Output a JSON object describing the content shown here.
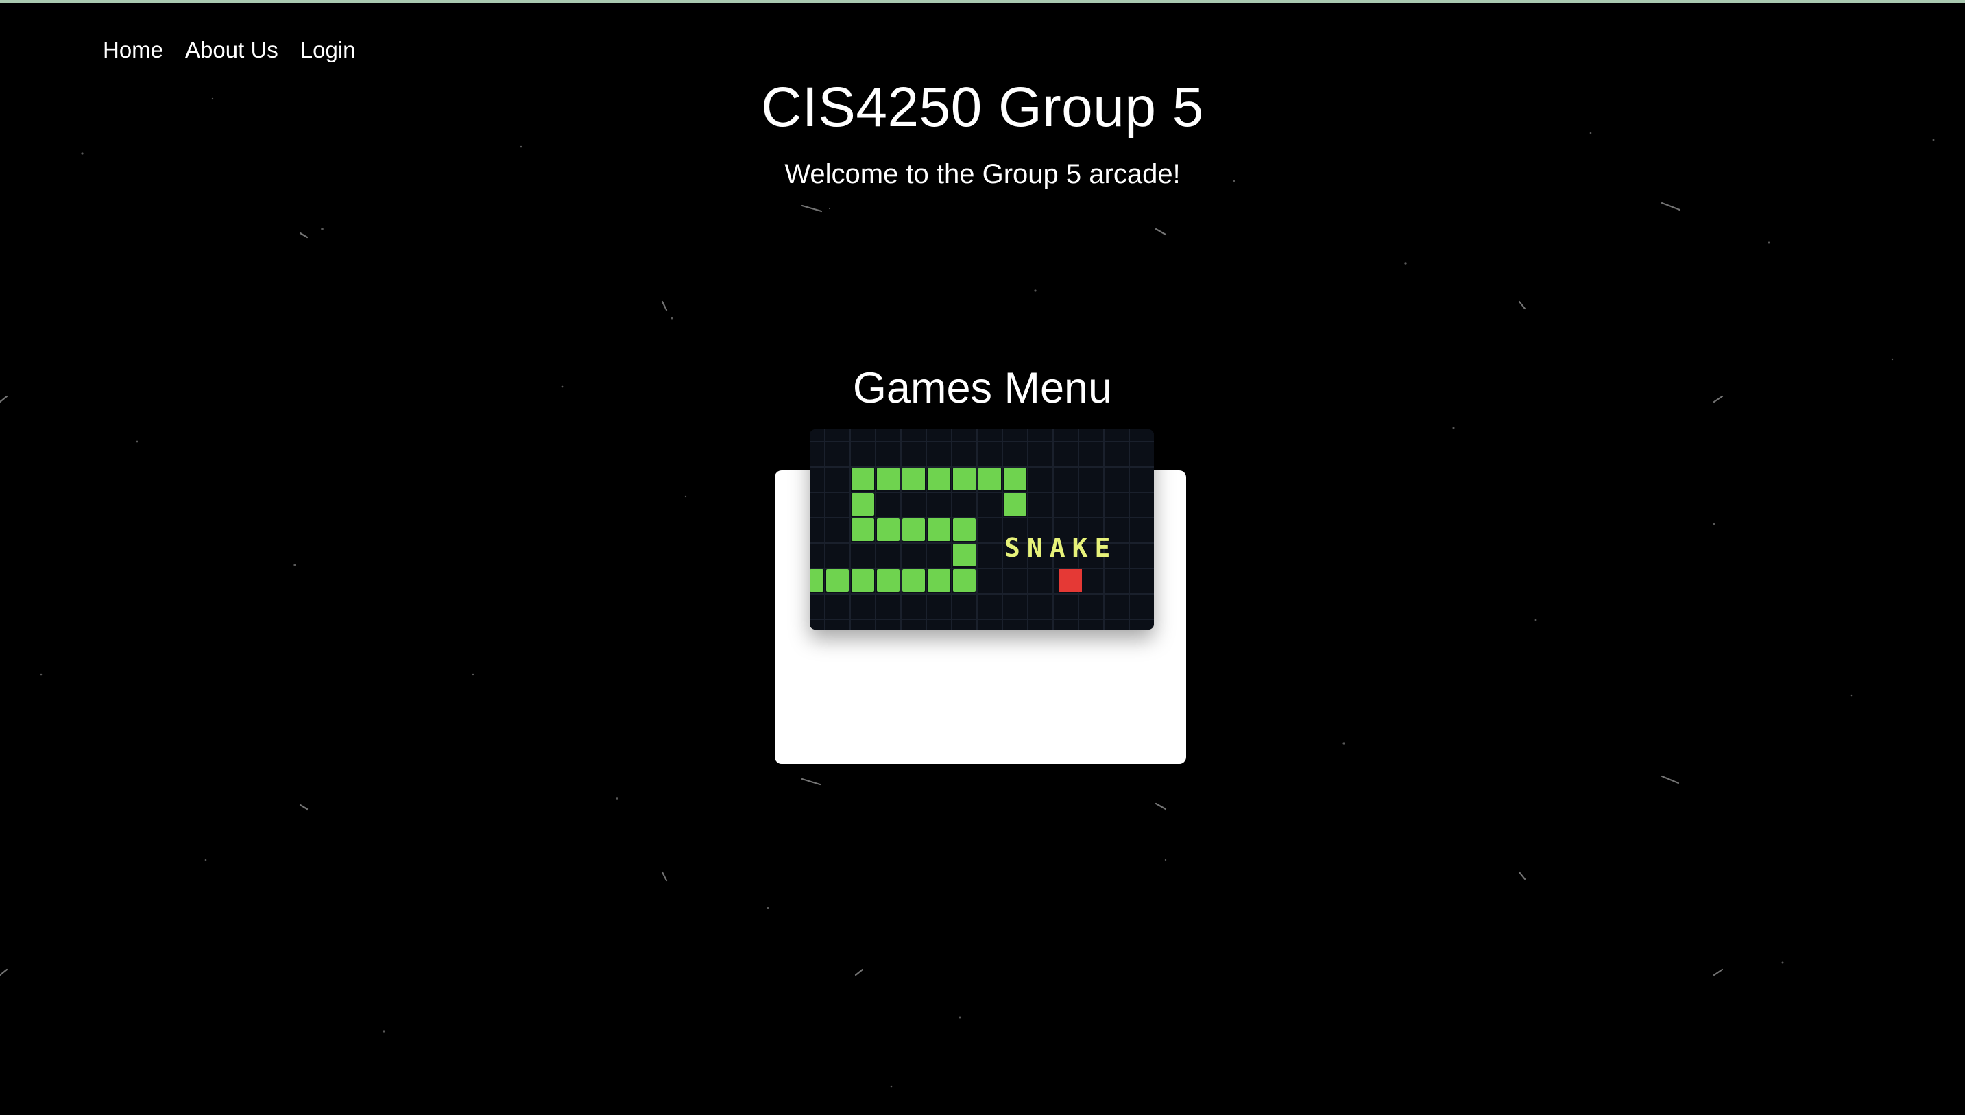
{
  "nav": {
    "items": [
      {
        "label": "Home"
      },
      {
        "label": "About Us"
      },
      {
        "label": "Login"
      }
    ]
  },
  "header": {
    "title": "CIS4250 Group 5",
    "subtitle": "Welcome to the Group 5 arcade!"
  },
  "games_menu": {
    "heading": "Games Menu",
    "games": [
      {
        "title_art_text": "SNAKE",
        "snake_color": "#6fd34f",
        "food_color": "#e53935",
        "text_color": "#e7f27a"
      }
    ]
  },
  "colors": {
    "background": "#000000",
    "card": "#ffffff",
    "top_strip": "#a9c9b0"
  }
}
